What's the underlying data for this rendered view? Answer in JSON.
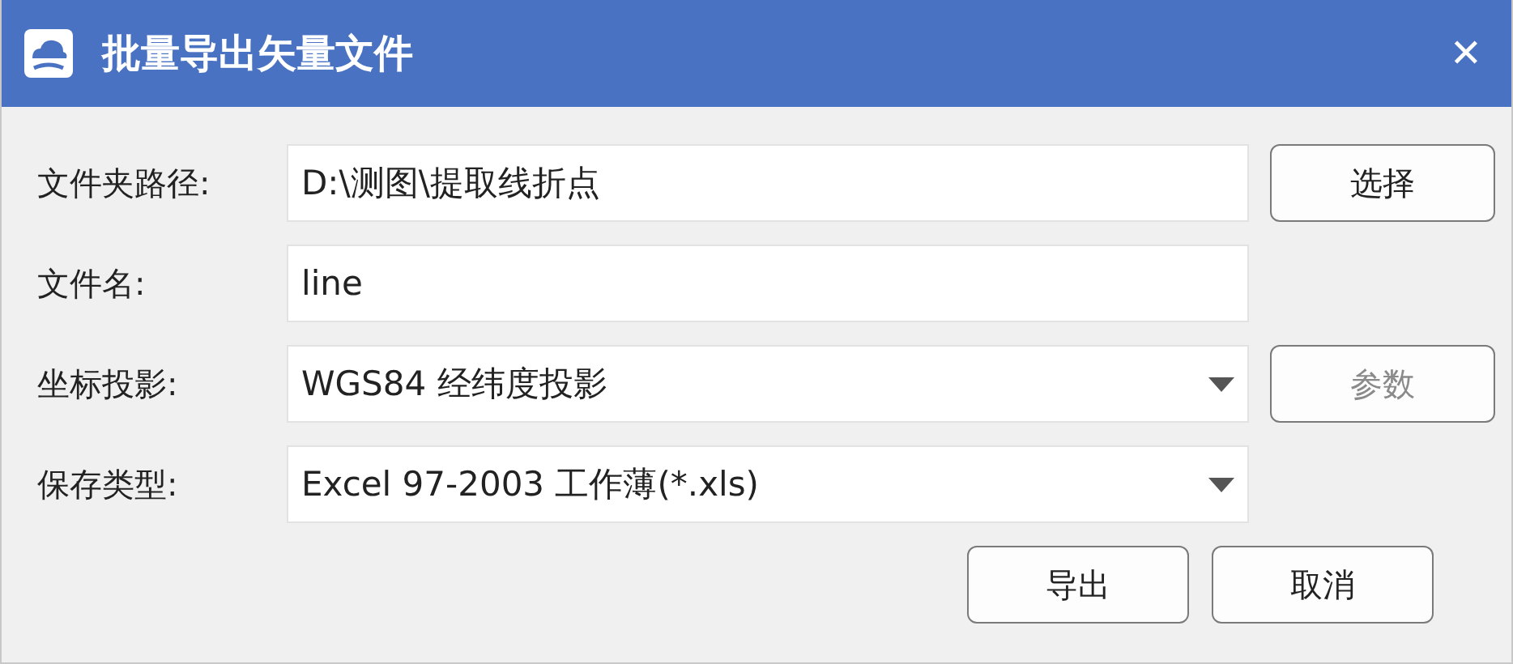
{
  "window": {
    "title": "批量导出矢量文件",
    "close": "✕"
  },
  "rows": [
    {
      "label": "文件夹路径:",
      "kind": "text",
      "value": "D:\\测图\\提取线折点",
      "button": {
        "label": "选择",
        "disabled": false
      }
    },
    {
      "label": "文件名:",
      "kind": "text",
      "value": "line"
    },
    {
      "label": "坐标投影:",
      "kind": "select",
      "value": "WGS84 经纬度投影",
      "button": {
        "label": "参数",
        "disabled": true
      }
    },
    {
      "label": "保存类型:",
      "kind": "select",
      "value": "Excel 97-2003 工作薄(*.xls)"
    }
  ],
  "buttons": [
    {
      "label": "导出",
      "disabled": false
    },
    {
      "label": "取消",
      "disabled": false
    }
  ]
}
